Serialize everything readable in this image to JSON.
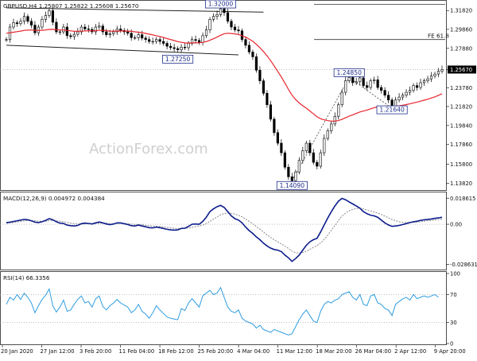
{
  "chart_data": {
    "type": "candlestick",
    "panels": [
      {
        "id": "price",
        "header": "GBPUSD,H4  1.25807 1.25822 1.25608 1.25670",
        "y_ticks": [
          "1.31820",
          "1.29860",
          "1.27880",
          "1.25670",
          "1.23780",
          "1.21820",
          "1.19840",
          "1.17860",
          "1.15800",
          "1.13820"
        ],
        "last_price": "1.25670",
        "ylim": [
          1.132,
          1.3275
        ],
        "price_series": [
          1.288,
          1.301,
          1.3055,
          1.3045,
          1.307,
          1.312,
          1.307,
          1.303,
          1.295,
          1.301,
          1.309,
          1.313,
          1.318,
          1.306,
          1.296,
          1.296,
          1.301,
          1.292,
          1.291,
          1.2935,
          1.296,
          1.301,
          1.299,
          1.2985,
          1.296,
          1.301,
          1.302,
          1.296,
          1.293,
          1.294,
          1.296,
          1.299,
          1.2975,
          1.296,
          1.2945,
          1.29,
          1.29,
          1.293,
          1.2895,
          1.288,
          1.286,
          1.286,
          1.288,
          1.286,
          1.284,
          1.281,
          1.2795,
          1.2785,
          1.2773,
          1.28,
          1.2795,
          1.284,
          1.288,
          1.287,
          1.285,
          1.292,
          1.298,
          1.309,
          1.312,
          1.314,
          1.32,
          1.316,
          1.307,
          1.301,
          1.298,
          1.297,
          1.288,
          1.282,
          1.275,
          1.27,
          1.256,
          1.245,
          1.232,
          1.22,
          1.205,
          1.191,
          1.18,
          1.17,
          1.155,
          1.145,
          1.1409,
          1.15,
          1.162,
          1.172,
          1.18,
          1.17,
          1.16,
          1.156,
          1.17,
          1.185,
          1.193,
          1.2,
          1.208,
          1.22,
          1.233,
          1.245,
          1.2485,
          1.243,
          1.244,
          1.248,
          1.24,
          1.238,
          1.245,
          1.246,
          1.238,
          1.235,
          1.23,
          1.225,
          1.2164,
          1.225,
          1.228,
          1.23,
          1.233,
          1.235,
          1.24,
          1.238,
          1.243,
          1.245,
          1.247,
          1.25,
          1.252,
          1.255,
          1.2567
        ],
        "ma_series": [
          1.2945,
          1.295,
          1.2956,
          1.2962,
          1.2968,
          1.2975,
          1.2978,
          1.2979,
          1.2975,
          1.2974,
          1.2976,
          1.2979,
          1.2985,
          1.2986,
          1.2982,
          1.2979,
          1.2979,
          1.2975,
          1.297,
          1.2966,
          1.2965,
          1.2967,
          1.2969,
          1.297,
          1.297,
          1.2972,
          1.2975,
          1.2975,
          1.2972,
          1.2968,
          1.2967,
          1.2968,
          1.2969,
          1.2969,
          1.2968,
          1.2965,
          1.296,
          1.2956,
          1.2951,
          1.2944,
          1.2935,
          1.2928,
          1.292,
          1.2911,
          1.2901,
          1.289,
          1.288,
          1.2869,
          1.2858,
          1.2851,
          1.2845,
          1.2843,
          1.2844,
          1.2845,
          1.2846,
          1.285,
          1.2858,
          1.2872,
          1.2888,
          1.2905,
          1.2925,
          1.294,
          1.2945,
          1.2943,
          1.2939,
          1.2932,
          1.292,
          1.2905,
          1.2885,
          1.2862,
          1.283,
          1.2795,
          1.2755,
          1.271,
          1.266,
          1.2605,
          1.2548,
          1.249,
          1.2425,
          1.236,
          1.23,
          1.2255,
          1.222,
          1.219,
          1.2165,
          1.2135,
          1.2105,
          1.2075,
          1.2055,
          1.2043,
          1.2035,
          1.203,
          1.203,
          1.2036,
          1.2048,
          1.2065,
          1.2082,
          1.2095,
          1.211,
          1.2125,
          1.2135,
          1.2145,
          1.2158,
          1.217,
          1.2178,
          1.2183,
          1.2186,
          1.2186,
          1.2182,
          1.2185,
          1.219,
          1.2195,
          1.2202,
          1.221,
          1.222,
          1.2228,
          1.2238,
          1.2248,
          1.2258,
          1.227,
          1.2283,
          1.2298,
          1.2315
        ],
        "annotations": [
          {
            "text": "1.32000",
            "x_index": 60,
            "price": 1.32
          },
          {
            "text": "1.27250",
            "x_index": 48,
            "price": 1.2725
          },
          {
            "text": "1.24850",
            "x_index": 96,
            "price": 1.2485
          },
          {
            "text": "1.21640",
            "x_index": 108,
            "price": 1.2164
          },
          {
            "text": "1.14090",
            "x_index": 80,
            "price": 1.1409
          }
        ],
        "fib_label": "FE 61.8",
        "fib_level": 1.288,
        "hline_top": 1.3245,
        "trend_upper": [
          [
            0,
            1.321
          ],
          [
            72,
            1.3165
          ]
        ],
        "trend_lower": [
          [
            0,
            1.282
          ],
          [
            65,
            1.272
          ]
        ],
        "dashed": [
          [
            80,
            1.1409
          ],
          [
            96,
            1.2485
          ],
          [
            108,
            1.2164
          ]
        ],
        "watermark": "ActionForex.com"
      },
      {
        "id": "macd",
        "header": "MACD(12,26,9) 0.004972 0.004384",
        "y_ticks": [
          "0.018615",
          "0.00",
          "-0.028631"
        ],
        "ylim": [
          -0.0312,
          0.0216
        ],
        "macd": [
          0.0012,
          0.0015,
          0.002,
          0.0025,
          0.003,
          0.0035,
          0.0032,
          0.0025,
          0.0015,
          0.0012,
          0.0018,
          0.0028,
          0.004,
          0.0032,
          0.0018,
          0.0008,
          0.0006,
          -0.0006,
          -0.001,
          -0.0012,
          -0.0008,
          0.0004,
          0.0008,
          0.0006,
          0.0002,
          0.001,
          0.0016,
          0.001,
          0.0002,
          -0.0003,
          0.0002,
          0.001,
          0.001,
          0.0004,
          -0.0002,
          -0.001,
          -0.0012,
          -0.0006,
          -0.0012,
          -0.0018,
          -0.0024,
          -0.0026,
          -0.002,
          -0.0024,
          -0.003,
          -0.0036,
          -0.004,
          -0.0042,
          -0.004,
          -0.003,
          -0.0028,
          -0.0015,
          0.0,
          0.0002,
          0.0,
          0.002,
          0.005,
          0.009,
          0.011,
          0.0125,
          0.0135,
          0.012,
          0.009,
          0.006,
          0.004,
          0.003,
          0.001,
          -0.002,
          -0.0045,
          -0.0065,
          -0.009,
          -0.011,
          -0.0135,
          -0.0155,
          -0.017,
          -0.018,
          -0.0185,
          -0.0195,
          -0.022,
          -0.024,
          -0.0265,
          -0.0245,
          -0.022,
          -0.0185,
          -0.015,
          -0.0125,
          -0.011,
          -0.01,
          -0.0055,
          -0.0005,
          0.0045,
          0.009,
          0.013,
          0.0165,
          0.0185,
          0.0175,
          0.016,
          0.0145,
          0.013,
          0.0115,
          0.009,
          0.0075,
          0.0065,
          0.006,
          0.005,
          0.003,
          0.001,
          -0.0005,
          -0.0015,
          -0.0012,
          -0.0008,
          -0.0002,
          0.0005,
          0.0012,
          0.0018,
          0.0022,
          0.0028,
          0.0032,
          0.0035,
          0.0038,
          0.0042,
          0.0045,
          0.005
        ],
        "signal": [
          0.0008,
          0.001,
          0.0013,
          0.0016,
          0.002,
          0.0024,
          0.0026,
          0.0026,
          0.0024,
          0.0022,
          0.0021,
          0.0022,
          0.0026,
          0.0027,
          0.0025,
          0.0022,
          0.0018,
          0.0013,
          0.0008,
          0.0004,
          0.0001,
          0.0001,
          0.0003,
          0.0004,
          0.0004,
          0.0005,
          0.0007,
          0.0008,
          0.0007,
          0.0005,
          0.0004,
          0.0005,
          0.0006,
          0.0006,
          0.0004,
          0.0001,
          -0.0001,
          -0.0002,
          -0.0004,
          -0.0007,
          -0.001,
          -0.0013,
          -0.0015,
          -0.0017,
          -0.0019,
          -0.0022,
          -0.0026,
          -0.0029,
          -0.0031,
          -0.0031,
          -0.003,
          -0.0027,
          -0.0022,
          -0.0017,
          -0.0013,
          -0.0006,
          0.0005,
          0.002,
          0.0036,
          0.0052,
          0.0067,
          0.0077,
          0.008,
          0.0078,
          0.0073,
          0.0064,
          0.0053,
          0.0038,
          0.0021,
          0.0003,
          -0.0016,
          -0.0035,
          -0.0055,
          -0.0075,
          -0.0094,
          -0.0111,
          -0.0126,
          -0.014,
          -0.0156,
          -0.0173,
          -0.0192,
          -0.0203,
          -0.0206,
          -0.0202,
          -0.0192,
          -0.0179,
          -0.0165,
          -0.0152,
          -0.0133,
          -0.0108,
          -0.0077,
          -0.0043,
          -0.0009,
          0.0026,
          0.0058,
          0.0081,
          0.0097,
          0.0107,
          0.0112,
          0.0113,
          0.0109,
          0.0102,
          0.0095,
          0.0088,
          0.008,
          0.007,
          0.0058,
          0.0046,
          0.0034,
          0.0025,
          0.0018,
          0.0014,
          0.0012,
          0.0012,
          0.0014,
          0.0016,
          0.0019,
          0.0022,
          0.0025,
          0.0028,
          0.0031,
          0.0034,
          0.0037
        ]
      },
      {
        "id": "rsi",
        "header": "RSI(14) 66.3356",
        "y_ticks": [
          "100",
          "70",
          "30",
          "0"
        ],
        "ylim": [
          0,
          100
        ],
        "rsi": [
          56,
          66,
          62,
          70,
          63,
          72,
          66,
          58,
          44,
          54,
          63,
          69,
          78,
          54,
          45,
          52,
          62,
          46,
          48,
          56,
          63,
          68,
          58,
          60,
          52,
          64,
          68,
          53,
          48,
          54,
          58,
          63,
          58,
          55,
          52,
          44,
          48,
          56,
          46,
          42,
          36,
          44,
          54,
          48,
          43,
          38,
          36,
          35,
          34,
          50,
          47,
          58,
          64,
          58,
          52,
          68,
          72,
          76,
          70,
          72,
          80,
          66,
          52,
          46,
          44,
          48,
          36,
          32,
          30,
          28,
          22,
          26,
          20,
          18,
          16,
          20,
          18,
          16,
          14,
          12,
          14,
          24,
          34,
          42,
          48,
          40,
          32,
          30,
          46,
          56,
          60,
          58,
          62,
          64,
          70,
          72,
          74,
          66,
          62,
          70,
          56,
          54,
          68,
          70,
          58,
          56,
          50,
          48,
          40,
          56,
          60,
          64,
          66,
          62,
          70,
          64,
          66,
          68,
          66,
          68,
          70,
          66
        ]
      }
    ],
    "x_labels": [
      "20 Jan 2020",
      "27 Jan 12:00",
      "3 Feb 20:00",
      "11 Feb 04:00",
      "18 Feb 12:00",
      "25 Feb 20:00",
      "4 Mar 04:00",
      "11 Mar 12:00",
      "18 Mar 20:00",
      "26 Mar 04:00",
      "2 Apr 12:00",
      "9 Apr 20:00"
    ],
    "colors": {
      "candle": "#000000",
      "ma": "#e8242c",
      "macd": "#0d1d8c",
      "signal": "#8a8a8a",
      "rsi": "#2f9de0",
      "label": "#1f2f8c",
      "grid": "#bfbfbf"
    }
  }
}
